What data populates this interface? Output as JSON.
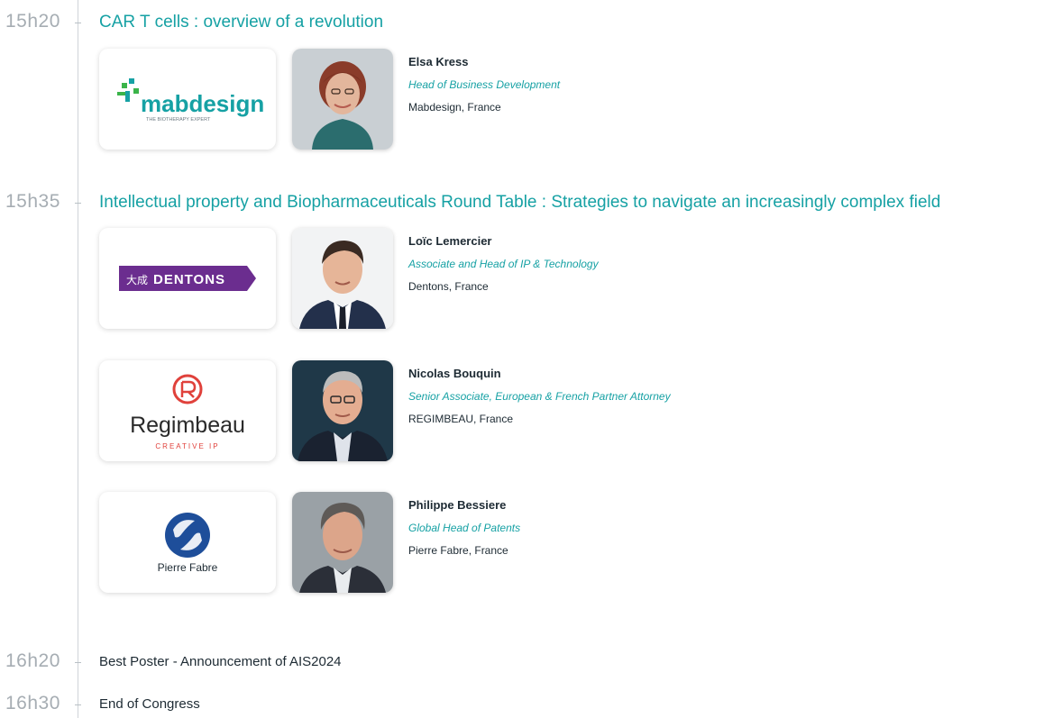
{
  "sessions": [
    {
      "time": "15h20",
      "title": "CAR T cells : overview of a revolution",
      "speakers": [
        {
          "name": "Elsa Kress",
          "role": "Head of Business Development",
          "org": "Mabdesign, France",
          "logo": {
            "wordmark": "mabdesign",
            "tagline": "THE BIOTHERAPY EXPERT"
          }
        }
      ]
    },
    {
      "time": "15h35",
      "title": "Intellectual property and Biopharmaceuticals Round Table : Strategies to navigate an increasingly complex field",
      "speakers": [
        {
          "name": "Loïc Lemercier",
          "role": "Associate and Head of IP & Technology",
          "org": "Dentons, France",
          "logo": {
            "prefix": "大成",
            "wordmark": "DENTONS"
          }
        },
        {
          "name": "Nicolas Bouquin",
          "role": "Senior Associate, European & French Partner Attorney",
          "org": "REGIMBEAU, France",
          "logo": {
            "wordmark": "Regimbeau",
            "tagline": "CREATIVE IP"
          }
        },
        {
          "name": "Philippe Bessiere",
          "role": "Global Head of Patents",
          "org": "Pierre Fabre, France",
          "logo": {
            "wordmark": "Pierre Fabre"
          }
        }
      ]
    },
    {
      "time": "16h20",
      "title": "Best Poster - Announcement of AIS2024"
    },
    {
      "time": "16h30",
      "title": "End of Congress"
    }
  ],
  "colors": {
    "accent": "#16a1a4",
    "time": "#a6adb3",
    "dentons_purple": "#6b2d8f",
    "regimbeau_red": "#e0413b",
    "pierre_fabre_blue": "#1e4e9a"
  }
}
